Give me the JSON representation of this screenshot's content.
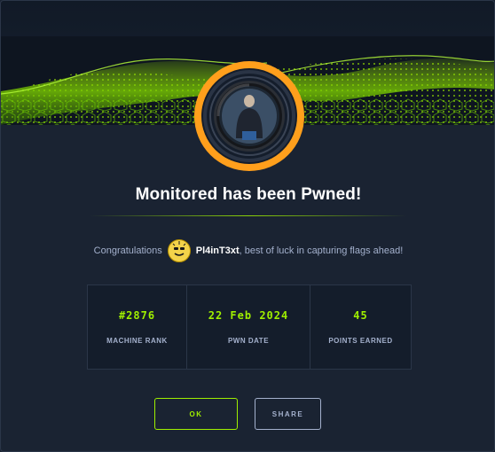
{
  "modal": {
    "title": "Monitored has been Pwned!",
    "congrats_prefix": "Congratulations",
    "username": "Pl4inT3xt",
    "congrats_suffix": ", best of luck in capturing flags ahead!",
    "stats": [
      {
        "value": "#2876",
        "label": "MACHINE RANK"
      },
      {
        "value": "22 Feb 2024",
        "label": "PWN DATE"
      },
      {
        "value": "45",
        "label": "POINTS EARNED"
      }
    ],
    "buttons": {
      "ok": "OK",
      "share": "SHARE"
    }
  },
  "colors": {
    "accent": "#9fef00",
    "background": "#1a2332",
    "muted_text": "#a4b1cd",
    "badge_ring": "#ff9f1c"
  },
  "icons": {
    "banner": "green-hacker-grid-banner",
    "badge": "machine-avatar-badge",
    "user_avatar": "user-avatar-icon"
  }
}
